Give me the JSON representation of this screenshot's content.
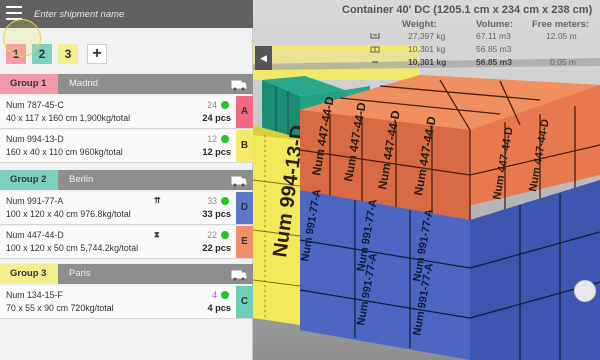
{
  "header": {
    "search_placeholder": "Enter shipment name"
  },
  "container": {
    "title": "Container 40' DC (1205.1 cm x 234 cm x 238 cm)",
    "columns": {
      "weight": "Weight:",
      "volume": "Volume:",
      "free": "Free meters:"
    },
    "rows": [
      {
        "icon": "crane-icon",
        "weight": "27,397 kg",
        "volume": "67.11 m3",
        "free": "12.05 m",
        "bold": false
      },
      {
        "icon": "box-load-icon",
        "weight": "10,301 kg",
        "volume": "56.85 m3",
        "free": "",
        "bold": false
      },
      {
        "icon": "sum-icon",
        "weight": "10,301 kg",
        "volume": "56.85 m3",
        "free": "0.05 m",
        "bold": true
      }
    ]
  },
  "tabs": [
    {
      "label": "1",
      "color": "#f29bab"
    },
    {
      "label": "2",
      "color": "#7fd1bf"
    },
    {
      "label": "3",
      "color": "#f4ef8e"
    }
  ],
  "add_label": "+",
  "groups": [
    {
      "label": "Group 1",
      "city": "Madrid",
      "color": "#f29bab",
      "items": [
        {
          "name": "Num 787-45-C",
          "dims": "40 x 117 x 160 cm 1,900kg/total",
          "count": "24",
          "pcs": "24 pcs",
          "letter": "A",
          "letter_color": "#f26a82",
          "mark": ""
        },
        {
          "name": "Num 994-13-D",
          "dims": "160 x 40 x 110 cm 960kg/total",
          "count": "12",
          "pcs": "12 pcs",
          "letter": "B",
          "letter_color": "#f4ea6a",
          "mark": ""
        }
      ]
    },
    {
      "label": "Group 2",
      "city": "Berlin",
      "color": "#7fd1bf",
      "items": [
        {
          "name": "Num 991-77-A",
          "dims": "100 x 120 x 40 cm 976.8kg/total",
          "count": "33",
          "pcs": "33 pcs",
          "letter": "D",
          "letter_color": "#5b78c9",
          "mark": "⇈"
        },
        {
          "name": "Num 447-44-D",
          "dims": "100 x 120 x 50 cm 5,744.2kg/total",
          "count": "22",
          "pcs": "22 pcs",
          "letter": "E",
          "letter_color": "#f08f6a",
          "mark": "⧗"
        }
      ]
    },
    {
      "label": "Group 3",
      "city": "Paris",
      "color": "#f4ef8e",
      "items": [
        {
          "name": "Num 134-15-F",
          "dims": "70 x 55 x 90 cm 720kg/total",
          "count": "4",
          "pcs": "4 pcs",
          "letter": "C",
          "letter_color": "#6fcfb6",
          "mark": ""
        }
      ]
    }
  ],
  "cargo_labels": {
    "big_d": "Num 994-13-D",
    "orange": "Num 447-44-D",
    "blue": "Num 991-77-A"
  }
}
